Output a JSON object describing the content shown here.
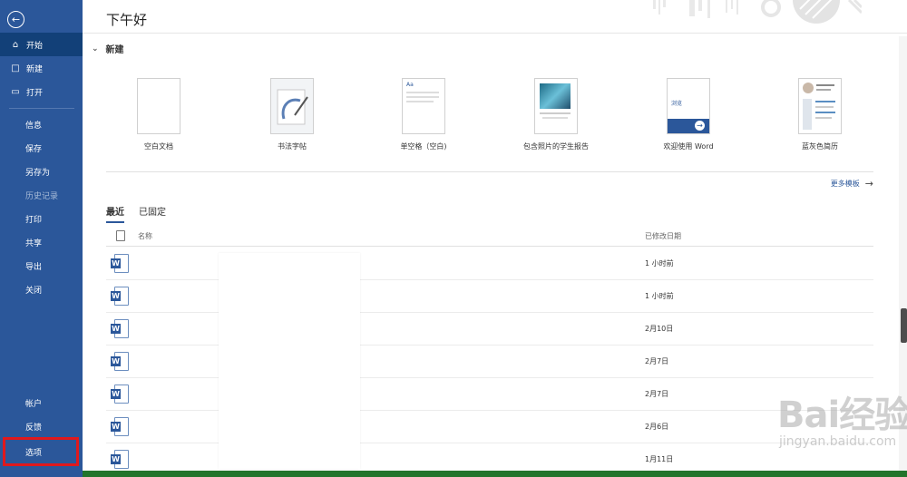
{
  "sidebar": {
    "back_icon": "arrow-left-circle-icon",
    "top_items": [
      {
        "label": "开始",
        "icon": "home-icon",
        "active": true
      },
      {
        "label": "新建",
        "icon": "new-document-icon"
      },
      {
        "label": "打开",
        "icon": "folder-open-icon"
      }
    ],
    "mid_items": [
      {
        "label": "信息"
      },
      {
        "label": "保存"
      },
      {
        "label": "另存为"
      },
      {
        "label": "历史记录",
        "disabled": true
      },
      {
        "label": "打印"
      },
      {
        "label": "共享"
      },
      {
        "label": "导出"
      },
      {
        "label": "关闭"
      }
    ],
    "bottom_items": [
      {
        "label": "帐户"
      },
      {
        "label": "反馈"
      },
      {
        "label": "选项",
        "highlighted": true
      }
    ],
    "highlight_color": "#e0191d",
    "bg_color": "#2b579a"
  },
  "main": {
    "greeting": "下午好",
    "new_section": {
      "heading": "新建",
      "templates": [
        {
          "caption": "空白文档",
          "thumb": "blank"
        },
        {
          "caption": "书法字帖",
          "thumb": "calligraphy"
        },
        {
          "caption": "单空格（空白)",
          "thumb": "single-spaced"
        },
        {
          "caption": "包含照片的学生报告",
          "thumb": "student-report"
        },
        {
          "caption": "欢迎使用 Word",
          "thumb": "welcome"
        },
        {
          "caption": "蓝灰色简历",
          "thumb": "resume"
        }
      ],
      "more_templates": "更多模板"
    },
    "tabs": [
      {
        "label": "最近",
        "active": true
      },
      {
        "label": "已固定"
      }
    ],
    "list": {
      "col_name": "名称",
      "col_date": "已修改日期",
      "rows": [
        {
          "date": "1 小时前"
        },
        {
          "date": "1 小时前"
        },
        {
          "date": "2月10日"
        },
        {
          "date": "2月7日"
        },
        {
          "date": "2月7日"
        },
        {
          "date": "2月6日"
        },
        {
          "date": "1月11日"
        }
      ]
    },
    "thumb_texts": {
      "single_spaced": "Aa",
      "welcome": "浏览"
    }
  },
  "watermark": {
    "main": "Bai经验",
    "sub": "jingyan.baidu.com"
  },
  "colors": {
    "word_blue": "#2b579a",
    "status_green": "#22752c"
  }
}
